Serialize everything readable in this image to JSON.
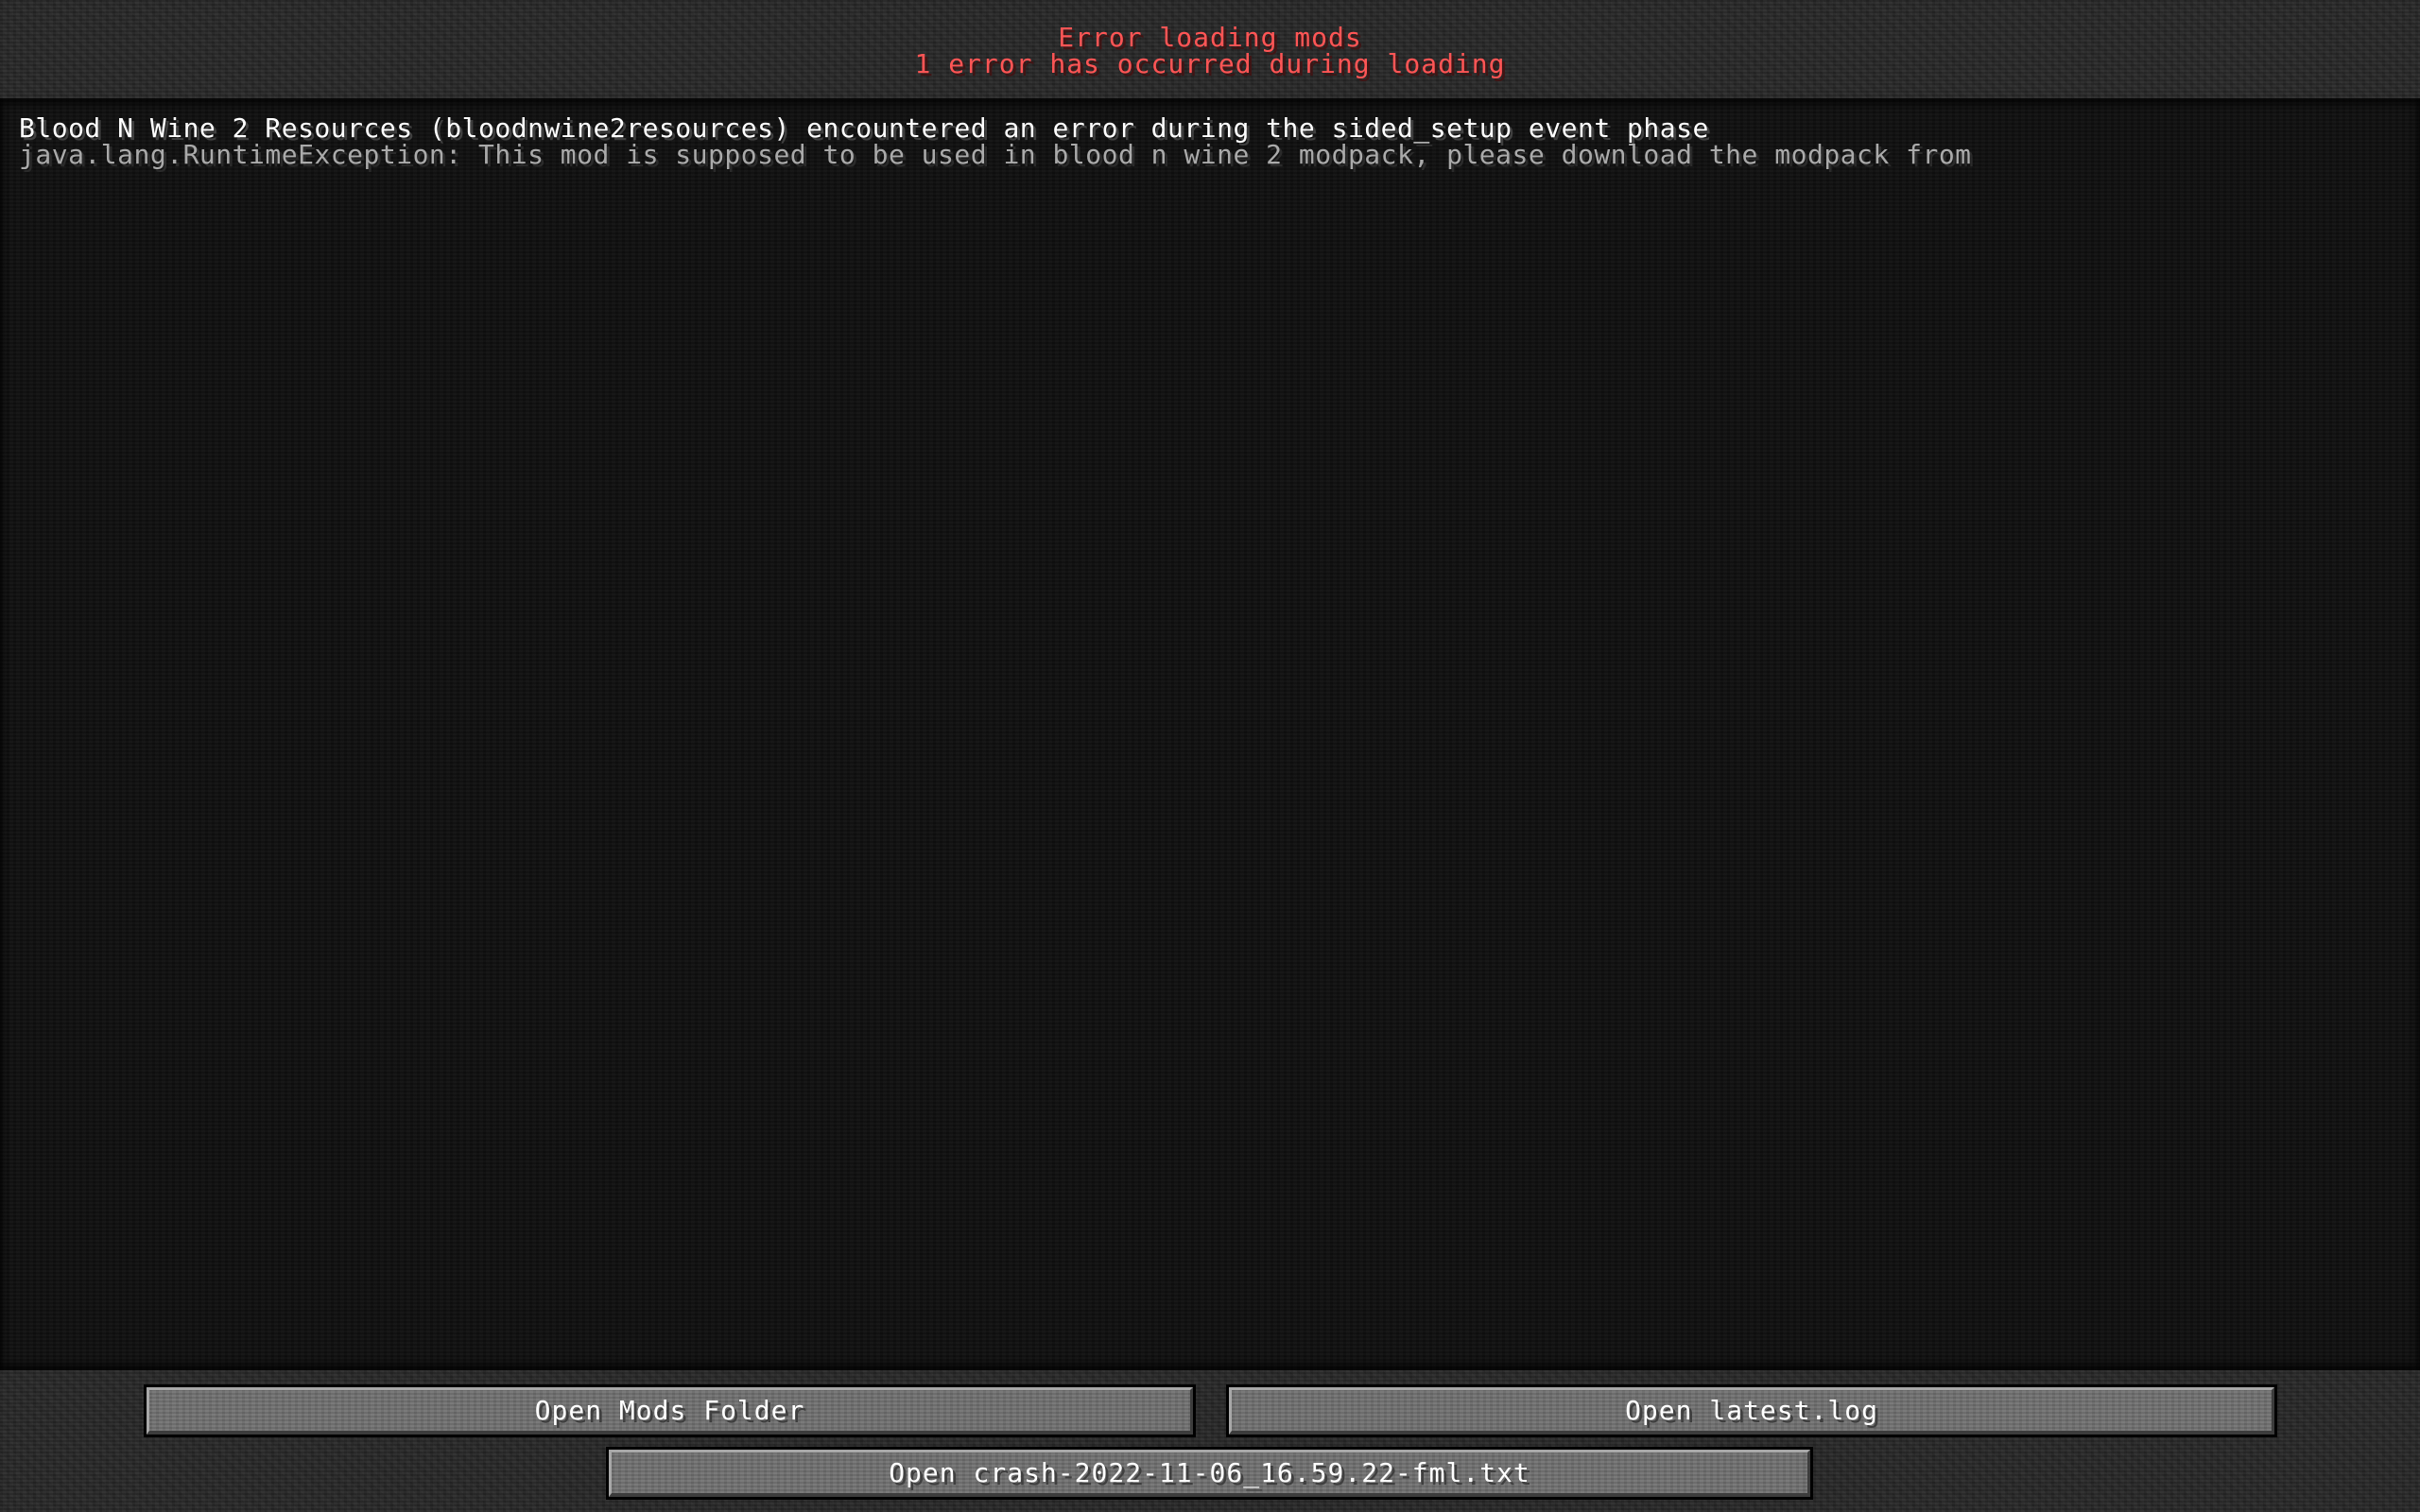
{
  "header": {
    "title": "Error loading mods",
    "subtitle": "1 error has occurred during loading",
    "color": "#ff5555"
  },
  "log": {
    "lines": [
      {
        "text": "Blood N Wine 2 Resources (bloodnwine2resources) encountered an error during the sided_setup event phase",
        "color": "#ffffff"
      },
      {
        "text": "java.lang.RuntimeException: This mod is supposed to be used in blood n wine 2 modpack, please download the modpack from",
        "color": "#aaaaaa"
      }
    ]
  },
  "buttons": {
    "open_mods_folder": "Open Mods Folder",
    "open_latest_log": "Open latest.log",
    "open_crash_report": "Open crash-2022-11-06_16.59.22-fml.txt"
  }
}
